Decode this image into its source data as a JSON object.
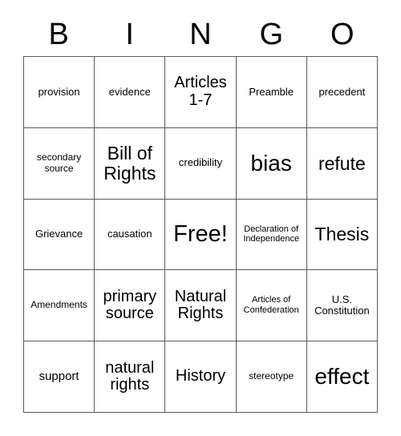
{
  "card": {
    "title": "BINGO",
    "header_letters": [
      "B",
      "I",
      "N",
      "G",
      "O"
    ],
    "rows": 5,
    "columns": 5,
    "border_color": "#5a5a5a",
    "background_color": "#ffffff",
    "text_color": "#000000",
    "free_space": {
      "label": "Free!",
      "row": 2,
      "column": 2
    },
    "cells": [
      [
        {
          "text": "provision",
          "size": "s"
        },
        {
          "text": "evidence",
          "size": "s"
        },
        {
          "text": "Articles\n1-7",
          "size": "l"
        },
        {
          "text": "Preamble",
          "size": "s"
        },
        {
          "text": "precedent",
          "size": "s"
        }
      ],
      [
        {
          "text": "secondary\nsource",
          "size": "xs"
        },
        {
          "text": "Bill of\nRights",
          "size": "xl"
        },
        {
          "text": "credibility",
          "size": "s"
        },
        {
          "text": "bias",
          "size": "xxl"
        },
        {
          "text": "refute",
          "size": "xl"
        }
      ],
      [
        {
          "text": "Grievance",
          "size": "s"
        },
        {
          "text": "causation",
          "size": "s"
        },
        {
          "text": "Free!",
          "size": "free"
        },
        {
          "text": "Declaration of\nIndependence",
          "size": "xxs"
        },
        {
          "text": "Thesis",
          "size": "xl"
        }
      ],
      [
        {
          "text": "Amendments",
          "size": "xs"
        },
        {
          "text": "primary\nsource",
          "size": "l"
        },
        {
          "text": "Natural\nRights",
          "size": "l"
        },
        {
          "text": "Articles of\nConfederation",
          "size": "xxs"
        },
        {
          "text": "U.S.\nConstitution",
          "size": "s"
        }
      ],
      [
        {
          "text": "support",
          "size": "m"
        },
        {
          "text": "natural\nrights",
          "size": "l"
        },
        {
          "text": "History",
          "size": "l"
        },
        {
          "text": "stereotype",
          "size": "xs"
        },
        {
          "text": "effect",
          "size": "xxl"
        }
      ]
    ]
  }
}
